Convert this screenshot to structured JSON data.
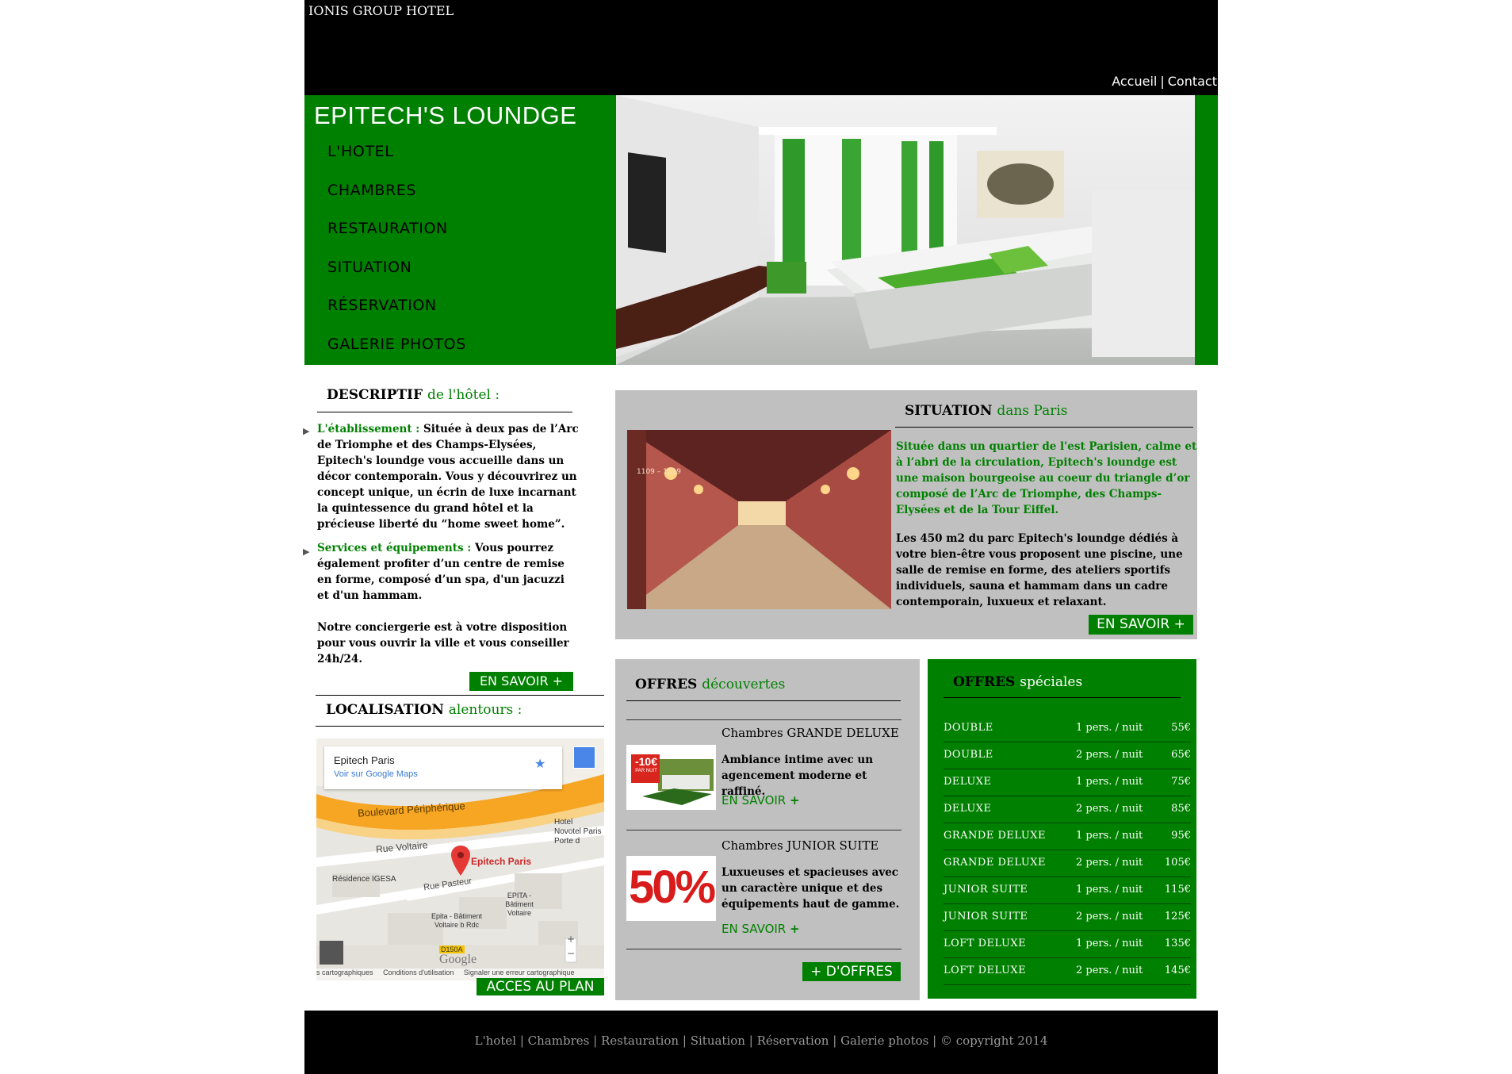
{
  "header": {
    "brand": "IONIS GROUP HOTEL",
    "links": [
      "Accueil",
      "Contact"
    ],
    "separator": "|"
  },
  "hero": {
    "site_title": "EPITECH'S LOUNDGE",
    "nav": [
      "L'HOTEL",
      "CHAMBRES",
      "RESTAURATION",
      "SITUATION",
      "RÉSERVATION",
      "GALERIE PHOTOS"
    ]
  },
  "description": {
    "title_strong": "DESCRIPTIF",
    "title_accent": "de l'hôtel :",
    "items": [
      {
        "label": "L'établissement :",
        "text": " Située à deux pas de l’Arc de Triomphe et des Champs-Elysées, Epitech's loundge vous accueille dans un décor contemporain. Vous y découvrirez un concept unique, un écrin de luxe incarnant la quintessence du grand hôtel et la précieuse liberté du “home sweet home”."
      },
      {
        "label": "Services et équipements :",
        "text": " Vous pourrez également profiter d’un centre de remise en forme, composé d’un spa, d'un jacuzzi et d'un hammam."
      }
    ],
    "extra": "Notre conciergerie est à votre disposition pour vous ouvrir la ville et vous conseiller 24h/24.",
    "button": "EN SAVOIR +"
  },
  "localisation": {
    "title_strong": "LOCALISATION",
    "title_accent": "alentours :",
    "map": {
      "place_name": "Epitech Paris",
      "view_link": "Voir sur Google Maps",
      "pin_label": "Epitech Paris",
      "streets": [
        "Boulevard Périphérique",
        "Rue Voltaire",
        "Rue Pasteur"
      ],
      "places": [
        "Résidence IGESA",
        "Hotel Novotel Paris Porte d",
        "EPITA - Bâtiment Voltaire",
        "Epita - Bâtiment Voltaire b Rdc",
        "D150A"
      ],
      "logo": "Google",
      "footer": [
        "s cartographiques",
        "Conditions d'utilisation",
        "Signaler une erreur cartographique"
      ],
      "zoom_in": "+",
      "zoom_out": "−"
    },
    "button": "ACCES AU PLAN"
  },
  "situation": {
    "title_strong": "SITUATION",
    "title_accent": "dans Paris",
    "image_caption": "1109 – 1119",
    "p1": "Située dans un quartier de l'est Parisien, calme et à l’abri de la circulation, Epitech's loundge est une maison bourgeoise au coeur du triangle d’or composé de l’Arc de Triomphe, des Champs-Elysées et de la Tour Eiffel.",
    "p2": "Les 450 m2 du parc Epitech's loundge dédiés à votre bien-être vous proposent une piscine, une salle de remise en forme, des ateliers sportifs individuels, sauna et hammam dans un cadre contemporain, luxueux et relaxant.",
    "button": "EN SAVOIR +"
  },
  "offres": {
    "title_strong": "OFFRES",
    "title_accent": "découvertes",
    "items": [
      {
        "name": "Chambres GRANDE DELUXE",
        "desc": "Ambiance intime avec un agencement moderne et raffiné.",
        "more": "EN SAVOIR",
        "badge_top": "-10€",
        "badge_sub": "PAR NUIT"
      },
      {
        "name": "Chambres JUNIOR SUITE",
        "desc": "Luxueuses et spacieuses avec un caractère unique et des équipements haut de gamme.",
        "more": "EN SAVOIR",
        "badge_top": "50%"
      }
    ],
    "plus": "+",
    "button": "+ D'OFFRES"
  },
  "speciales": {
    "title_strong": "OFFRES",
    "title_accent": "spéciales",
    "rows": [
      {
        "name": "DOUBLE",
        "pers": "1 pers. / nuit",
        "price": "55€"
      },
      {
        "name": "DOUBLE",
        "pers": "2 pers. / nuit",
        "price": "65€"
      },
      {
        "name": "DELUXE",
        "pers": "1 pers. / nuit",
        "price": "75€"
      },
      {
        "name": "DELUXE",
        "pers": "2 pers. / nuit",
        "price": "85€"
      },
      {
        "name": "GRANDE DELUXE",
        "pers": "1 pers. / nuit",
        "price": "95€"
      },
      {
        "name": "GRANDE DELUXE",
        "pers": "2 pers. / nuit",
        "price": "105€"
      },
      {
        "name": "JUNIOR SUITE",
        "pers": "1 pers. / nuit",
        "price": "115€"
      },
      {
        "name": "JUNIOR SUITE",
        "pers": "2 pers. / nuit",
        "price": "125€"
      },
      {
        "name": "LOFT DELUXE",
        "pers": "1 pers. / nuit",
        "price": "135€"
      },
      {
        "name": "LOFT DELUXE",
        "pers": "2 pers. / nuit",
        "price": "145€"
      }
    ]
  },
  "footer": {
    "links": [
      "L'hotel",
      "Chambres",
      "Restauration",
      "Situation",
      "Réservation",
      "Galerie photos"
    ],
    "copyright": "© copyright 2014",
    "separator": "|"
  },
  "colors": {
    "accent": "#008000",
    "panel": "#c0c0c0",
    "header": "#000000"
  }
}
